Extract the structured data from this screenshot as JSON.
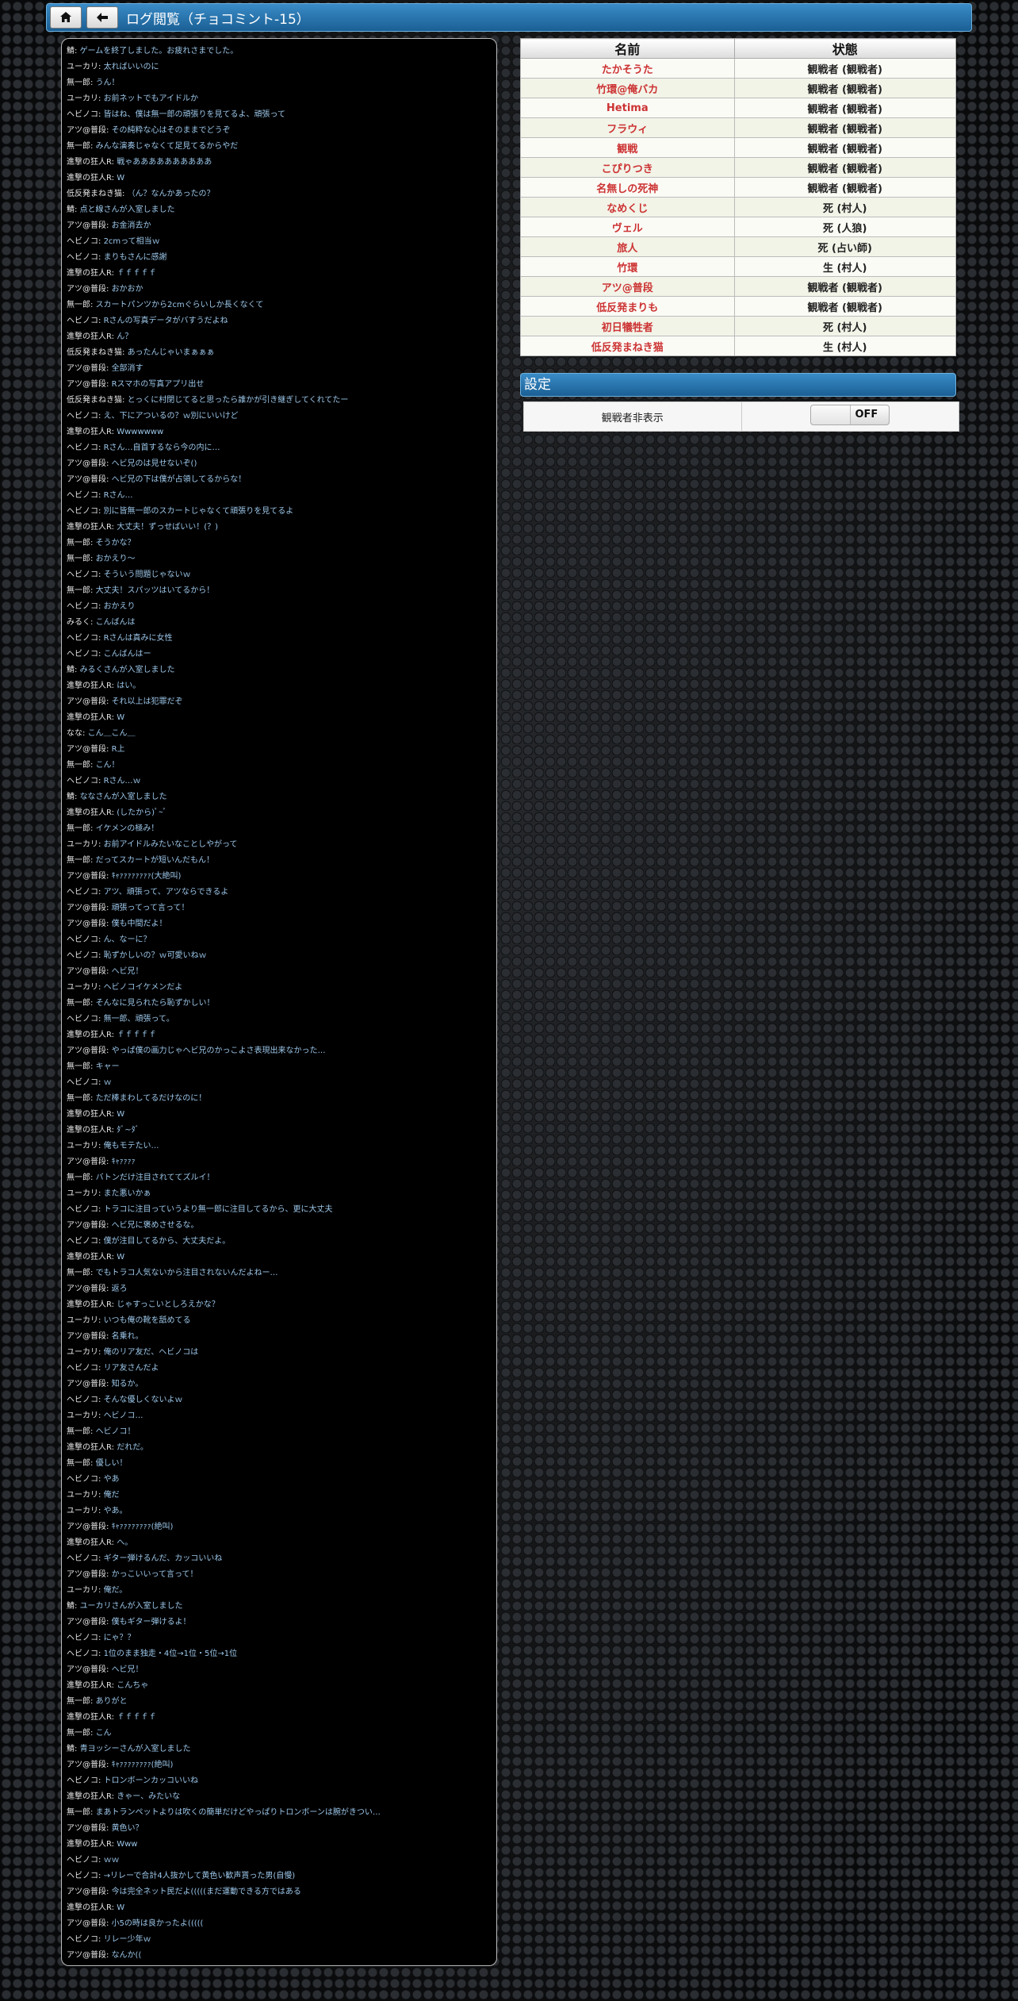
{
  "header": {
    "title": "ログ閲覧（チョコミント-15）",
    "home_icon": "house",
    "back_icon": "arrow-left"
  },
  "log": [
    {
      "s": "鯖",
      "t": "ゲームを終了しました。お疲れさまでした。"
    },
    {
      "s": "ユーカリ",
      "t": "太ればいいのに"
    },
    {
      "s": "無一郎",
      "t": "うん！"
    },
    {
      "s": "ユーカリ",
      "t": "お前ネットでもアイドルか"
    },
    {
      "s": "ヘビノコ",
      "t": "皆はね、僕は無一郎の頑張りを見てるよ、頑張って"
    },
    {
      "s": "アツ@普段",
      "t": "その純粋な心はそのままでどうぞ"
    },
    {
      "s": "無一郎",
      "t": "みんな演奏じゃなくて足見てるからやだ"
    },
    {
      "s": "進撃の狂人R",
      "t": "戦ゃああああああああああ"
    },
    {
      "s": "進撃の狂人R",
      "t": "W"
    },
    {
      "s": "低反発まねき猫",
      "t": "（ん？なんかあったの？"
    },
    {
      "s": "鯖",
      "t": "点と線さんが入室しました"
    },
    {
      "s": "アツ@普段",
      "t": "お金消去か"
    },
    {
      "s": "ヘビノコ",
      "t": "2cmって相当ｗ"
    },
    {
      "s": "ヘビノコ",
      "t": "まりもさんに感謝"
    },
    {
      "s": "進撃の狂人R",
      "t": "ｆｆｆｆｆ"
    },
    {
      "s": "アツ@普段",
      "t": "おかおか"
    },
    {
      "s": "無一郎",
      "t": "スカートパンツから2cmぐらいしか長くなくて"
    },
    {
      "s": "ヘビノコ",
      "t": "Rさんの写真データがバすうだよね"
    },
    {
      "s": "進撃の狂人R",
      "t": "ん？"
    },
    {
      "s": "低反発まねき猫",
      "t": "あったんじゃいまぁぁぁ"
    },
    {
      "s": "アツ@普段",
      "t": "全部消す"
    },
    {
      "s": "アツ@普段",
      "t": "Rスマホの写真アプリ出せ"
    },
    {
      "s": "低反発まねき猫",
      "t": "とっくに村閉じてると思ったら誰かが引き継ぎしてくれてたー"
    },
    {
      "s": "ヘビノコ",
      "t": "え、下にアついるの？ｗ別にいいけど"
    },
    {
      "s": "進撃の狂人R",
      "t": "Wwwwwww"
    },
    {
      "s": "ヘビノコ",
      "t": "Rさん…自首するなら今の内に…"
    },
    {
      "s": "アツ@普段",
      "t": "へビ兄のは見せないぞ()"
    },
    {
      "s": "アツ@普段",
      "t": "へビ兄の下は僕が占領してるからな！"
    },
    {
      "s": "ヘビノコ",
      "t": "Rさん…"
    },
    {
      "s": "ヘビノコ",
      "t": "別に皆無一郎のスカートじゃなくて頑張りを見てるよ"
    },
    {
      "s": "進撃の狂人R",
      "t": "大丈夫！ずっせばいい！(？)"
    },
    {
      "s": "無一郎",
      "t": "そうかな？"
    },
    {
      "s": "無一郎",
      "t": "おかえり〜"
    },
    {
      "s": "ヘビノコ",
      "t": "そういう問題じゃないｗ"
    },
    {
      "s": "無一郎",
      "t": "大丈夫！スパッツはいてるから！"
    },
    {
      "s": "ヘビノコ",
      "t": "おかえり"
    },
    {
      "s": "みるく",
      "t": "こんばんは"
    },
    {
      "s": "ヘビノコ",
      "t": "Rさんは真みに女性"
    },
    {
      "s": "ヘビノコ",
      "t": "こんばんはー"
    },
    {
      "s": "鯖",
      "t": "みるくさんが入室しました"
    },
    {
      "s": "進撃の狂人R",
      "t": "はい。"
    },
    {
      "s": "アツ@普段",
      "t": "それ以上は犯罪だぞ"
    },
    {
      "s": "進撃の狂人R",
      "t": "W"
    },
    {
      "s": "なな",
      "t": "こん＿こん＿"
    },
    {
      "s": "アツ@普段",
      "t": "R上"
    },
    {
      "s": "無一郎",
      "t": "こん！"
    },
    {
      "s": "ヘビノコ",
      "t": "Rさん…ｗ"
    },
    {
      "s": "鯖",
      "t": "ななさんが入室しました"
    },
    {
      "s": "進撃の狂人R",
      "t": "(したから)ﾟ~ﾟ"
    },
    {
      "s": "無一郎",
      "t": "イケメンの極み！"
    },
    {
      "s": "ユーカリ",
      "t": "お前アイドルみたいなことしやがって"
    },
    {
      "s": "無一郎",
      "t": "だってスカートが短いんだもん！"
    },
    {
      "s": "アツ@普段",
      "t": "ｷｬｧｧｧｧｧｧｧｧ(大絶叫)"
    },
    {
      "s": "ヘビノコ",
      "t": "アツ、頑張って、アツならできるよ"
    },
    {
      "s": "アツ@普段",
      "t": "頑張ってって言って！"
    },
    {
      "s": "アツ@普段",
      "t": "僕も中間だよ！"
    },
    {
      "s": "ヘビノコ",
      "t": "ん、なーに？"
    },
    {
      "s": "ヘビノコ",
      "t": "恥ずかしいの？ｗ可愛いねｗ"
    },
    {
      "s": "アツ@普段",
      "t": "へビ兄！"
    },
    {
      "s": "ユーカリ",
      "t": "ヘビノコイケメンだよ"
    },
    {
      "s": "無一郎",
      "t": "そんなに見られたら恥ずかしい！"
    },
    {
      "s": "ヘビノコ",
      "t": "無一郎、頑張って。"
    },
    {
      "s": "進撃の狂人R",
      "t": "ｆｆｆｆｆ"
    },
    {
      "s": "アツ@普段",
      "t": "やっぱ僕の画力じゃへビ兄のかっこよさ表現出来なかった…"
    },
    {
      "s": "無一郎",
      "t": "キャー"
    },
    {
      "s": "ヘビノコ",
      "t": "ｗ"
    },
    {
      "s": "無一郎",
      "t": "ただ棒まわしてるだけなのに！"
    },
    {
      "s": "進撃の狂人R",
      "t": "W"
    },
    {
      "s": "進撃の狂人R",
      "t": "ﾀﾞ~ﾀﾞ"
    },
    {
      "s": "ユーカリ",
      "t": "俺もモテたい…"
    },
    {
      "s": "アツ@普段",
      "t": "ｷｬｧｧｧｧ"
    },
    {
      "s": "無一郎",
      "t": "バトンだけ注目されててズルイ！"
    },
    {
      "s": "ユーカリ",
      "t": "また悪いかぁ"
    },
    {
      "s": "ヘビノコ",
      "t": "トラコに注目っていうより無一郎に注目してるから、更に大丈夫"
    },
    {
      "s": "アツ@普段",
      "t": "へビ兄に褒めさせるな。"
    },
    {
      "s": "ヘビノコ",
      "t": "僕が注目してるから、大丈夫だよ。"
    },
    {
      "s": "進撃の狂人R",
      "t": "W"
    },
    {
      "s": "無一郎",
      "t": "でもトラコ人気ないから注目されないんだよねー…"
    },
    {
      "s": "アツ@普段",
      "t": "返ろ"
    },
    {
      "s": "進撃の狂人R",
      "t": "じゃすっこいとしろえかな？"
    },
    {
      "s": "ユーカリ",
      "t": "いつも俺の靴を舐めてる"
    },
    {
      "s": "アツ@普段",
      "t": "名乗れ。"
    },
    {
      "s": "ユーカリ",
      "t": "俺のリア友だ、ヘビノコは"
    },
    {
      "s": "ヘビノコ",
      "t": "リア友さんだよ"
    },
    {
      "s": "アツ@普段",
      "t": "知るか。"
    },
    {
      "s": "ヘビノコ",
      "t": "そんな優しくないよｗ"
    },
    {
      "s": "ユーカリ",
      "t": "ヘビノコ…"
    },
    {
      "s": "無一郎",
      "t": "ヘビノコ！"
    },
    {
      "s": "進撃の狂人R",
      "t": "だれだ。"
    },
    {
      "s": "無一郎",
      "t": "優しい！"
    },
    {
      "s": "ヘビノコ",
      "t": "やあ"
    },
    {
      "s": "ユーカリ",
      "t": "俺だ"
    },
    {
      "s": "ユーカリ",
      "t": "やあ。"
    },
    {
      "s": "アツ@普段",
      "t": "ｷｬｧｧｧｧｧｧｧｧ(絶叫)"
    },
    {
      "s": "進撃の狂人R",
      "t": "へ。"
    },
    {
      "s": "ヘビノコ",
      "t": "ギター弾けるんだ、カッコいいね"
    },
    {
      "s": "アツ@普段",
      "t": "かっこいいって言って！"
    },
    {
      "s": "ユーカリ",
      "t": "俺だ。"
    },
    {
      "s": "鯖",
      "t": "ユーカリさんが入室しました"
    },
    {
      "s": "アツ@普段",
      "t": "僕もギター弾けるよ！"
    },
    {
      "s": "ヘビノコ",
      "t": "にゃ？？"
    },
    {
      "s": "ヘビノコ",
      "t": "1位のまま独走・4位→1位・5位→1位"
    },
    {
      "s": "アツ@普段",
      "t": "へビ兄！"
    },
    {
      "s": "進撃の狂人R",
      "t": "こんちゃ"
    },
    {
      "s": "無一郎",
      "t": "ありがと"
    },
    {
      "s": "進撃の狂人R",
      "t": "ｆｆｆｆｆ"
    },
    {
      "s": "無一郎",
      "t": "こん"
    },
    {
      "s": "鯖",
      "t": "青ヨッシーさんが入室しました"
    },
    {
      "s": "アツ@普段",
      "t": "ｷｬｧｧｧｧｧｧｧｧ(絶叫)"
    },
    {
      "s": "ヘビノコ",
      "t": "トロンボーンカッコいいね"
    },
    {
      "s": "進撃の狂人R",
      "t": "きゃー、みたいな"
    },
    {
      "s": "無一郎",
      "t": "まあトランペットよりは吹くの簡単だけどやっぱりトロンボーンは腕がきつい…"
    },
    {
      "s": "アツ@普段",
      "t": "黄色い？"
    },
    {
      "s": "進撃の狂人R",
      "t": "Www"
    },
    {
      "s": "ヘビノコ",
      "t": "ｗｗ"
    },
    {
      "s": "ヘビノコ",
      "t": "→リレーで合計4人抜かして黄色い歓声貰った男(自慢)"
    },
    {
      "s": "アツ@普段",
      "t": "今は完全ネット民だよ(((((まだ運動できる方ではある"
    },
    {
      "s": "進撃の狂人R",
      "t": "W"
    },
    {
      "s": "アツ@普段",
      "t": "小5の時は良かったよ((((("
    },
    {
      "s": "ヘビノコ",
      "t": "リレー少年ｗ"
    },
    {
      "s": "アツ@普段",
      "t": "なんか(("
    }
  ],
  "players_table": {
    "headers": [
      "名前",
      "状態"
    ],
    "rows": [
      {
        "name": "たかそうた",
        "status": "観戦者 (観戦者)"
      },
      {
        "name": "竹環@俺バカ",
        "status": "観戦者 (観戦者)"
      },
      {
        "name": "Hetima",
        "status": "観戦者 (観戦者)"
      },
      {
        "name": "フラウィ",
        "status": "観戦者 (観戦者)"
      },
      {
        "name": "観戦",
        "status": "観戦者 (観戦者)"
      },
      {
        "name": "こぴりつき",
        "status": "観戦者 (観戦者)"
      },
      {
        "name": "名無しの死神",
        "status": "観戦者 (観戦者)"
      },
      {
        "name": "なめくじ",
        "status": "死 (村人)"
      },
      {
        "name": "ヴェル",
        "status": "死 (人狼)"
      },
      {
        "name": "旅人",
        "status": "死 (占い師)"
      },
      {
        "name": "竹環",
        "status": "生 (村人)"
      },
      {
        "name": "アツ@普段",
        "status": "観戦者 (観戦者)"
      },
      {
        "name": "低反発まりも",
        "status": "観戦者 (観戦者)"
      },
      {
        "name": "初日犠牲者",
        "status": "死 (村人)"
      },
      {
        "name": "低反発まねき猫",
        "status": "生 (村人)"
      }
    ]
  },
  "settings": {
    "title": "設定",
    "hide_spectators_label": "観戦者非表示",
    "hide_spectators_value": "OFF"
  },
  "colors": {
    "header_gradient_top": "#3a8cc8",
    "header_gradient_bottom": "#1a5f94",
    "player_name": "#cc3333",
    "log_text": "#9cc7ea"
  }
}
